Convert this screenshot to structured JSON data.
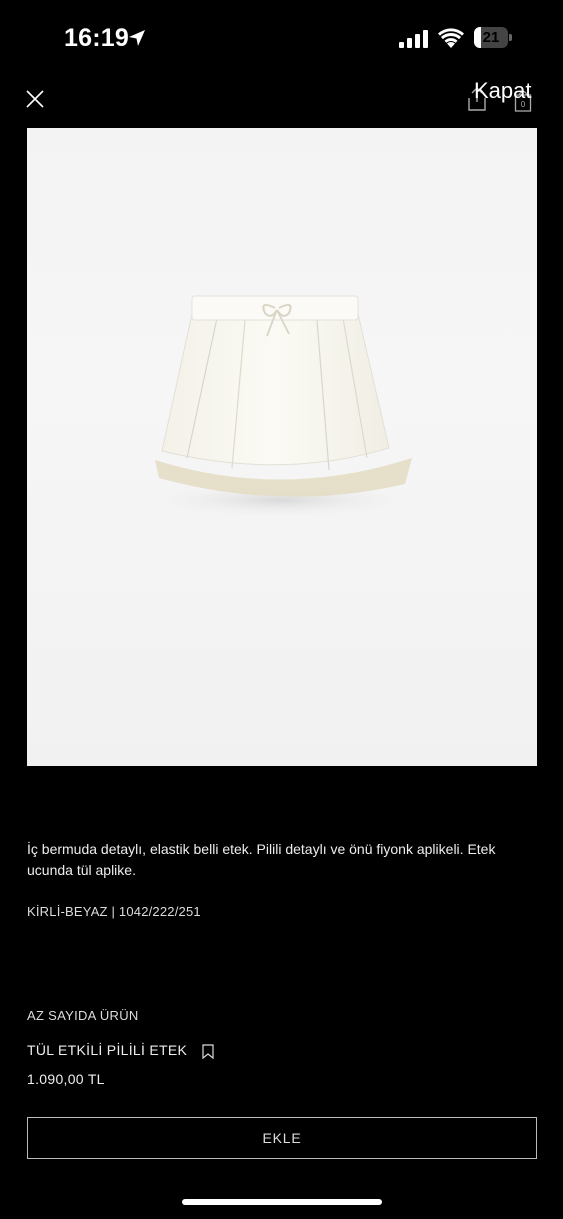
{
  "status_bar": {
    "time": "16:19",
    "battery": "21",
    "battery_level_percent": 21
  },
  "header": {
    "close_label": "Kapat",
    "cart_count": "0"
  },
  "product": {
    "description": "İç bermuda detaylı, elastik belli etek. Pilili detaylı ve önü fiyonk aplikeli. Etek ucunda tül aplike.",
    "color_code": "KİRLİ-BEYAZ | 1042/222/251",
    "stock_notice": "AZ SAYIDA ÜRÜN",
    "name": "TÜL ETKİLİ PİLİLİ ETEK",
    "price": "1.090,00 TL",
    "add_button": "EKLE"
  },
  "icons": {
    "location": "location-arrow-icon",
    "signal": "cellular-signal-icon",
    "wifi": "wifi-icon",
    "battery": "battery-icon",
    "close": "close-icon",
    "share": "share-icon",
    "cart": "shopping-bag-icon",
    "bookmark": "bookmark-icon"
  }
}
